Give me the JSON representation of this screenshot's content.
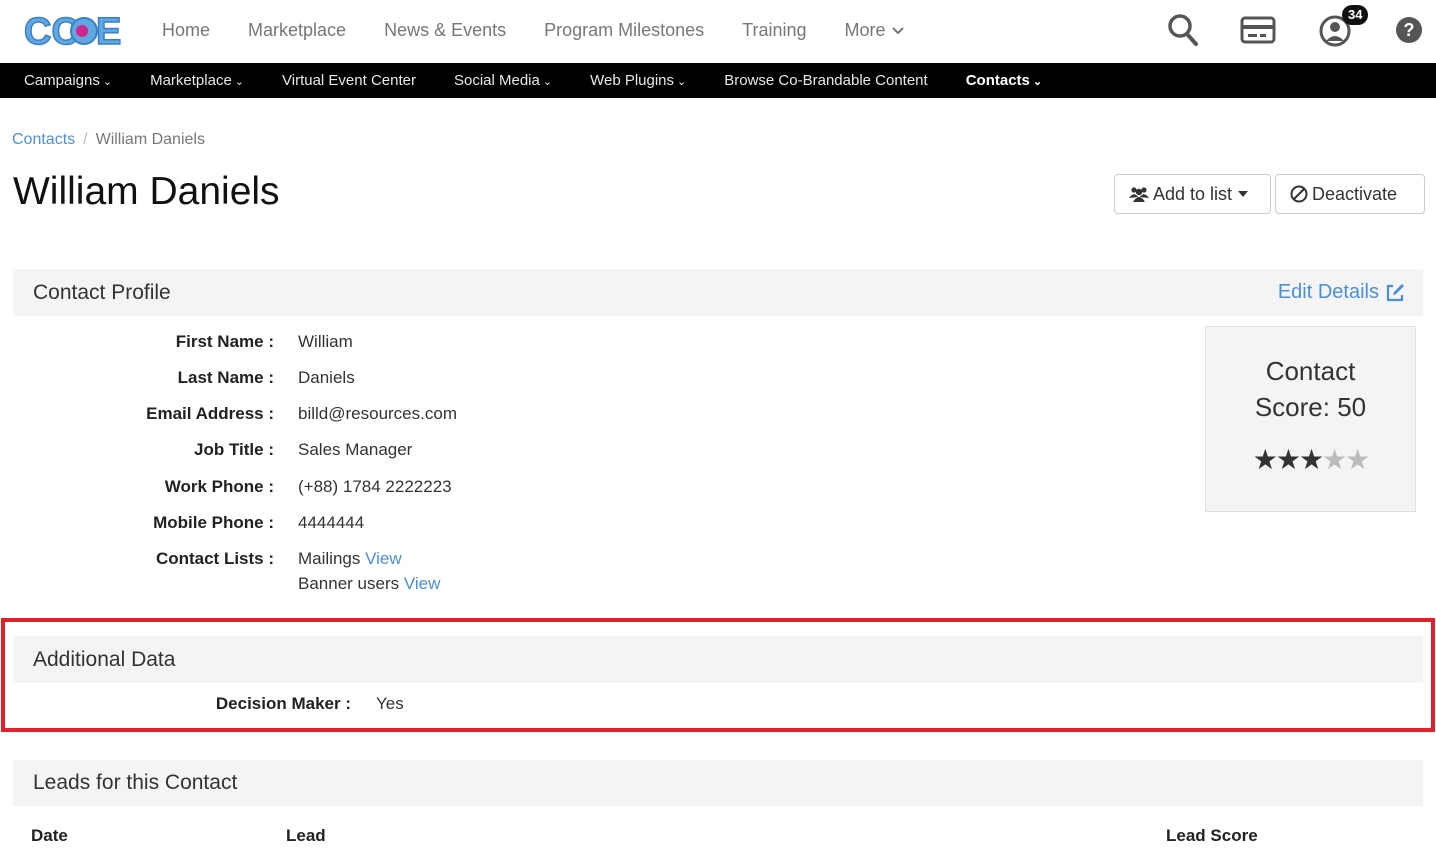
{
  "brand": {
    "logo_text": "CCOE",
    "accent": "#4a90d9",
    "logo_colors": [
      "#5fa8e0",
      "#3a7fc7",
      "#d4258f"
    ]
  },
  "top_nav": {
    "items": [
      "Home",
      "Marketplace",
      "News & Events",
      "Program Milestones",
      "Training",
      "More"
    ],
    "icons": [
      "search-icon",
      "card-icon",
      "user-icon",
      "help-icon"
    ],
    "notification_count": "34"
  },
  "sub_nav": {
    "items": [
      {
        "label": "Campaigns",
        "dropdown": true
      },
      {
        "label": "Marketplace",
        "dropdown": true
      },
      {
        "label": "Virtual Event Center",
        "dropdown": false
      },
      {
        "label": "Social Media",
        "dropdown": true
      },
      {
        "label": "Web Plugins",
        "dropdown": true
      },
      {
        "label": "Browse Co-Brandable Content",
        "dropdown": false
      },
      {
        "label": "Contacts",
        "dropdown": true,
        "active": true
      }
    ]
  },
  "breadcrumb": {
    "parent": "Contacts",
    "separator": "/",
    "current": "William Daniels"
  },
  "page": {
    "title": "William Daniels"
  },
  "actions": {
    "add_to_list": "Add to list",
    "deactivate": "Deactivate"
  },
  "profile": {
    "heading": "Contact Profile",
    "edit_label": "Edit Details",
    "fields": [
      {
        "label": "First Name :",
        "value": "William"
      },
      {
        "label": "Last Name :",
        "value": "Daniels"
      },
      {
        "label": "Email Address :",
        "value": "billd@resources.com"
      },
      {
        "label": "Job Title :",
        "value": "Sales Manager"
      },
      {
        "label": "Work Phone :",
        "value": "(+88) 1784 2222223"
      },
      {
        "label": "Mobile Phone :",
        "value": "4444444"
      }
    ],
    "contact_lists_label": "Contact Lists :",
    "contact_lists": [
      {
        "name": "Mailings",
        "link": "View"
      },
      {
        "name": "Banner users",
        "link": "View"
      }
    ]
  },
  "score": {
    "label_line1": "Contact",
    "label_line2": "Score: 50",
    "stars_filled": 3,
    "stars_total": 5
  },
  "additional": {
    "heading": "Additional Data",
    "fields": [
      {
        "label": "Decision Maker :",
        "value": "Yes"
      }
    ]
  },
  "leads": {
    "heading": "Leads for this Contact",
    "columns": [
      "Date",
      "Lead",
      "Lead Score"
    ]
  },
  "highlight_color": "#e0202a"
}
